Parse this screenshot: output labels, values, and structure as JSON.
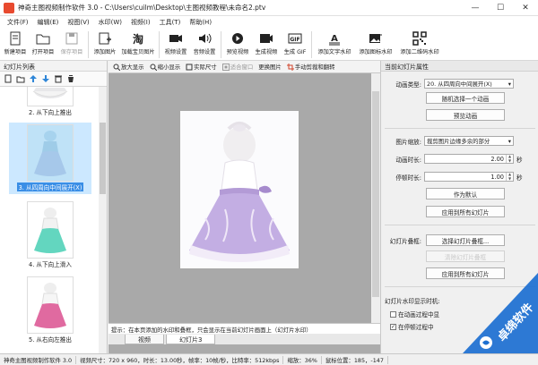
{
  "window": {
    "title": "神奇主图视频制作软件 3.0 - C:\\Users\\cuilm\\Desktop\\主图视频教程\\未命名2.ptv",
    "controls": {
      "minimize": "—",
      "maximize": "☐",
      "close": "✕"
    }
  },
  "menu": [
    "文件(F)",
    "编辑(E)",
    "视图(V)",
    "水印(W)",
    "视频(I)",
    "工具(T)",
    "帮助(H)"
  ],
  "toolbar": [
    {
      "label": "新建项目",
      "icon": "new-project-icon",
      "enabled": true
    },
    {
      "label": "打开项目",
      "icon": "open-folder-icon",
      "enabled": true
    },
    {
      "label": "保存项目",
      "icon": "save-icon",
      "enabled": false
    },
    {
      "label": "添加图片",
      "icon": "add-image-icon",
      "enabled": true
    },
    {
      "label": "加载宝贝图片",
      "icon": "taobao-icon",
      "enabled": true
    },
    {
      "label": "视频设置",
      "icon": "video-settings-icon",
      "enabled": true
    },
    {
      "label": "音频设置",
      "icon": "audio-settings-icon",
      "enabled": true
    },
    {
      "label": "预览视频",
      "icon": "preview-video-icon",
      "enabled": true
    },
    {
      "label": "生成视频",
      "icon": "generate-video-icon",
      "enabled": true
    },
    {
      "label": "生成 GIF",
      "icon": "gif-icon",
      "enabled": true
    },
    {
      "label": "添加文字水印",
      "icon": "text-watermark-icon",
      "enabled": true
    },
    {
      "label": "添加图标水印",
      "icon": "image-watermark-icon",
      "enabled": true
    },
    {
      "label": "添加二维码水印",
      "icon": "qrcode-icon",
      "enabled": true
    }
  ],
  "left_panel": {
    "title": "幻灯片列表",
    "slides": [
      {
        "label": "2. 从下向上推出",
        "selected": false,
        "dress_color": "#e8e8ea"
      },
      {
        "label": "3. 从四周向中间展开(X)",
        "selected": true,
        "dress_color": "#b89ad8"
      },
      {
        "label": "4. 从下向上滑入",
        "selected": false,
        "dress_color": "#63d6bf"
      },
      {
        "label": "5. 从右向左推出",
        "selected": false,
        "dress_color": "#e06aa0"
      }
    ]
  },
  "canvas_toolbar": [
    {
      "label": "放大显示",
      "icon": "zoom-in-icon",
      "enabled": true
    },
    {
      "label": "缩小显示",
      "icon": "zoom-out-icon",
      "enabled": true
    },
    {
      "label": "实际尺寸",
      "icon": "actual-size-icon",
      "enabled": true
    },
    {
      "label": "适合窗口",
      "icon": "fit-window-icon",
      "enabled": false
    },
    {
      "label": "更换图片",
      "icon": "replace-image-icon",
      "enabled": true
    },
    {
      "label": "手动剪裁和翻转",
      "icon": "crop-icon",
      "enabled": true
    }
  ],
  "hint": "提示：在本页添加的水印和叠框，只会显示在当前幻灯片画面上（幻灯片水印）",
  "tabs": [
    {
      "label": "视频",
      "active": false
    },
    {
      "label": "幻灯片3",
      "active": true
    }
  ],
  "right_panel": {
    "title": "当前幻灯片属性",
    "anim_type_label": "动画类型:",
    "anim_type_value": "20. 从四周向中间展开(X)",
    "random_anim_button": "随机选择一个动画",
    "preview_anim_button": "预览动画",
    "image_scale_label": "图片缩放:",
    "image_scale_value": "裁剪图片边缘多余的部分",
    "anim_duration_label": "动画时长:",
    "anim_duration_value": "2.00",
    "pause_duration_label": "停顿时长:",
    "pause_duration_value": "1.00",
    "seconds_unit": "秒",
    "set_default_button": "作为默认",
    "apply_all_button": "应用到所有幻灯片",
    "overlay_label": "幻灯片叠框:",
    "choose_overlay_button": "选择幻灯片叠框...",
    "clear_overlay_button": "清除幻灯片叠框",
    "apply_all_overlay_button": "应用到所有幻灯片",
    "watermark_display_label": "幻灯片水印显示时机:",
    "wm_during_anim": "在动画过程中显",
    "wm_during_pause": "在停顿过程中"
  },
  "status": {
    "app": "神奇主图视频制作软件 3.0",
    "video_info": "视频尺寸：720 x 960，时长：13.00秒，帧率：10帧/秒，比特率：512kbps",
    "zoom": "缩放：36%",
    "mouse": "鼠标位置：185，-147"
  },
  "watermark": {
    "text": "卓绵软件"
  },
  "colors": {
    "selected_slide_bg": "#cce8ff",
    "selected_label_bg": "#3a8ee6",
    "watermark_blue": "#1c6fd1"
  }
}
